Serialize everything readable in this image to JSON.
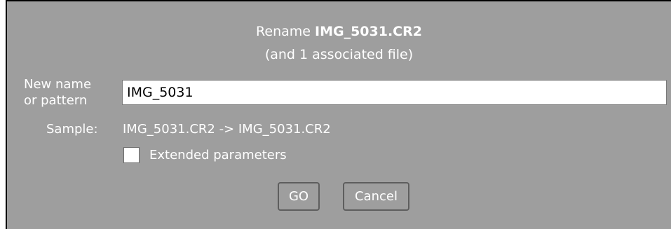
{
  "dialog": {
    "title_prefix": "Rename ",
    "filename": "IMG_5031.CR2",
    "subtitle": "(and 1 associated file)",
    "new_name_label_line1": "New name",
    "new_name_label_line2": "or pattern",
    "new_name_value": "IMG_5031",
    "sample_label": "Sample:",
    "sample_value": "IMG_5031.CR2 -> IMG_5031.CR2",
    "extended_label": "Extended parameters",
    "extended_checked": false,
    "go_label": "GO",
    "cancel_label": "Cancel"
  },
  "colors": {
    "background": "#9e9e9e",
    "text": "#ffffff",
    "input_bg": "#ffffff",
    "button_border": "#5e5e5e"
  }
}
